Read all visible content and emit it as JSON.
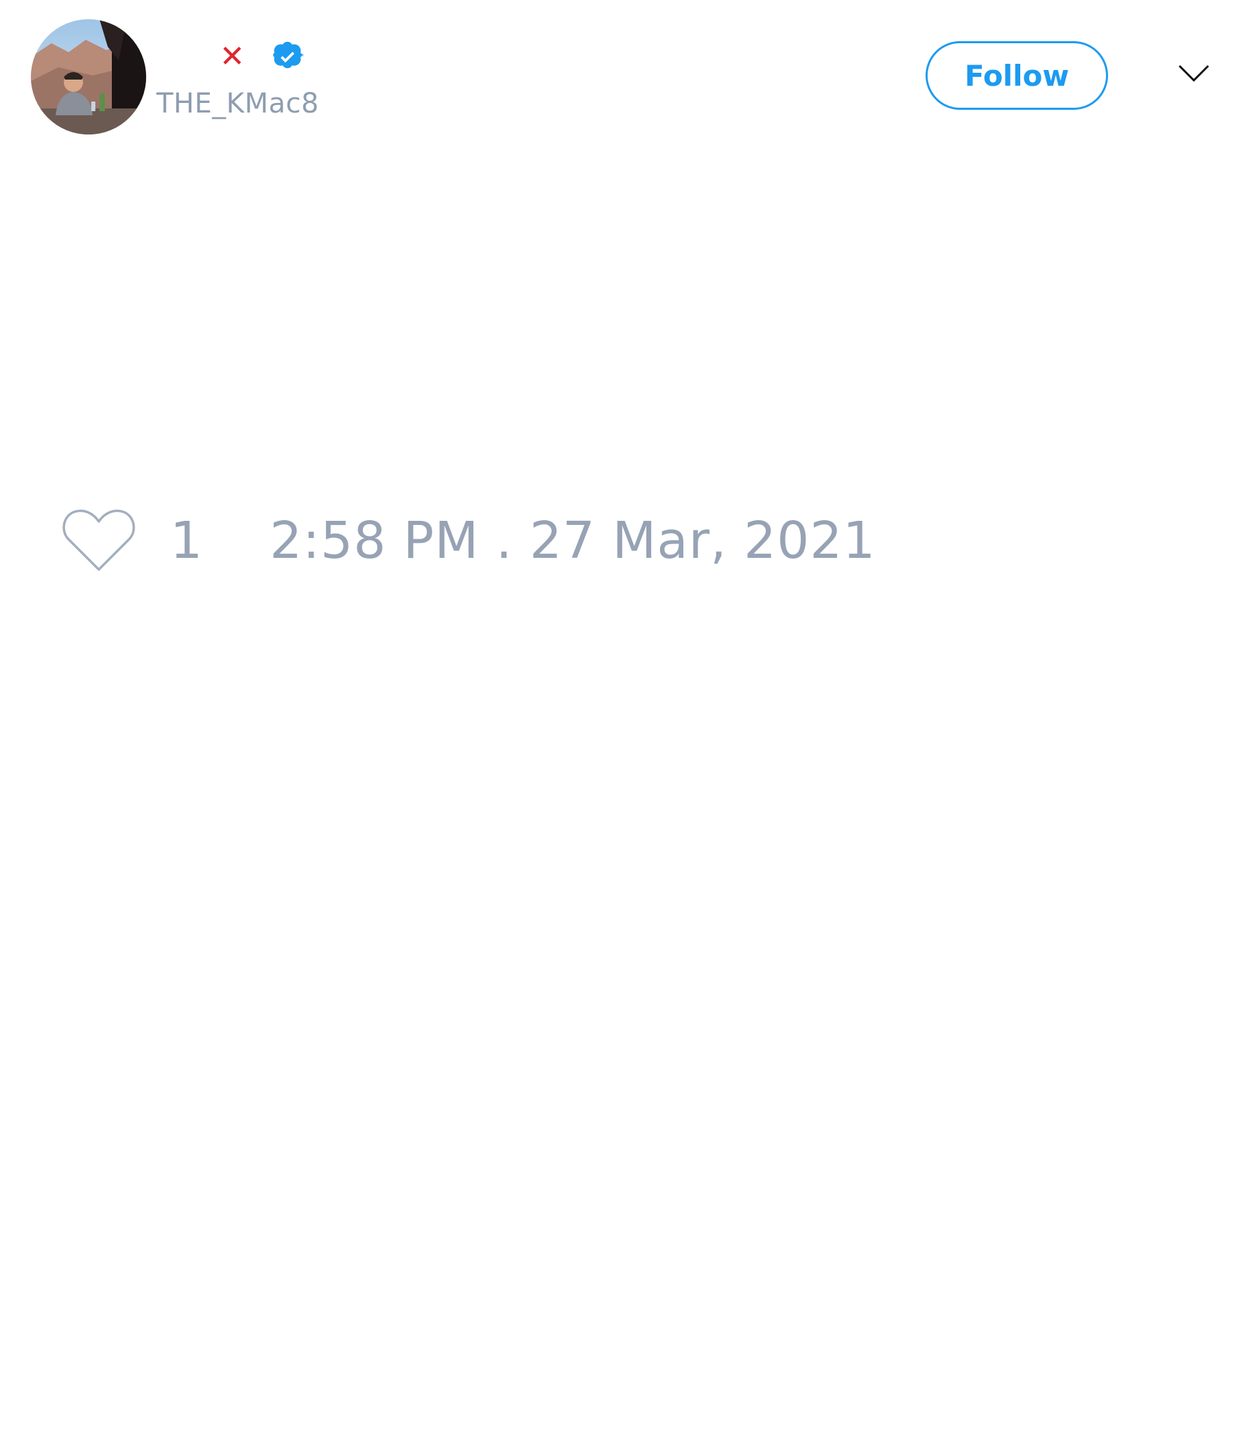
{
  "tweet": {
    "author": {
      "display_name_icon": "red-x-mark",
      "verified_icon": "verified-badge-icon",
      "handle": "THE_KMac8",
      "avatar_description": "photo avatar"
    },
    "follow_label": "Follow",
    "menu_icon": "chevron-down-icon",
    "like_icon": "heart-outline-icon",
    "like_count": "1",
    "timestamp": "2:58 PM . 27 Mar, 2021"
  },
  "colors": {
    "accent": "#1d9bf0",
    "muted_text": "#97a3b5",
    "x_mark": "#e0252b"
  }
}
